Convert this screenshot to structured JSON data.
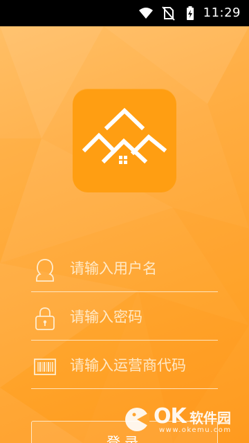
{
  "status_bar": {
    "time": "11:29",
    "icons": [
      "wifi-icon",
      "no-sim-icon",
      "battery-charging-icon"
    ]
  },
  "logo": {
    "icon": "house-roofs-logo-icon",
    "tile_color": "#ff9e12"
  },
  "form": {
    "username": {
      "placeholder": "请输入用户名",
      "value": "",
      "icon": "user-avatar-icon"
    },
    "password": {
      "placeholder": "请输入密码",
      "value": "",
      "icon": "padlock-icon"
    },
    "operator_code": {
      "placeholder": "请输入运营商代码",
      "value": "",
      "icon": "barcode-icon"
    },
    "login_label": "登录"
  },
  "watermark": {
    "brand": "OK",
    "name": "软件园",
    "url": "www.okemu.com"
  },
  "colors": {
    "background_top": "#ffc16a",
    "background_bottom": "#ff9a1e",
    "accent": "#ff9e12",
    "status_bar": "#000000"
  }
}
